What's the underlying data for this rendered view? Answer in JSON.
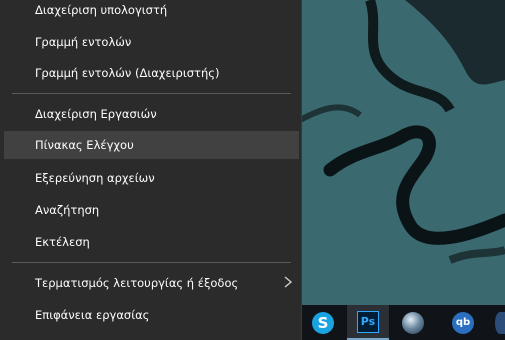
{
  "menu": {
    "items": [
      {
        "label": "Διαχείριση υπολογιστή"
      },
      {
        "label": "Γραμμή εντολών"
      },
      {
        "label": "Γραμμή εντολών (Διαχειριστής)"
      },
      {
        "label": "Διαχείριση Εργασιών"
      },
      {
        "label": "Πίνακας Ελέγχου"
      },
      {
        "label": "Εξερεύνηση αρχείων"
      },
      {
        "label": "Αναζήτηση"
      },
      {
        "label": "Εκτέλεση"
      },
      {
        "label": "Τερματισμός λειτουργίας ή έξοδος"
      },
      {
        "label": "Επιφάνεια εργασίας"
      }
    ],
    "highlighted_item": "Πίνακας Ελέγχου",
    "submenu_indicator": "chevron-right-icon"
  },
  "taskbar": {
    "icons": [
      {
        "name": "skype-icon",
        "glyph": "S"
      },
      {
        "name": "photoshop-icon",
        "glyph": "Ps",
        "active": true
      },
      {
        "name": "globe-icon",
        "glyph": ""
      },
      {
        "name": "qbittorrent-icon",
        "glyph": "qb"
      },
      {
        "name": "app-icon",
        "glyph": ""
      }
    ]
  },
  "colors": {
    "menu_bg": "#2b2b2b",
    "highlight_bg": "#414141",
    "separator": "#5a5a5a",
    "taskbar_bg": "#101418",
    "accent": "#7aa7c7"
  }
}
